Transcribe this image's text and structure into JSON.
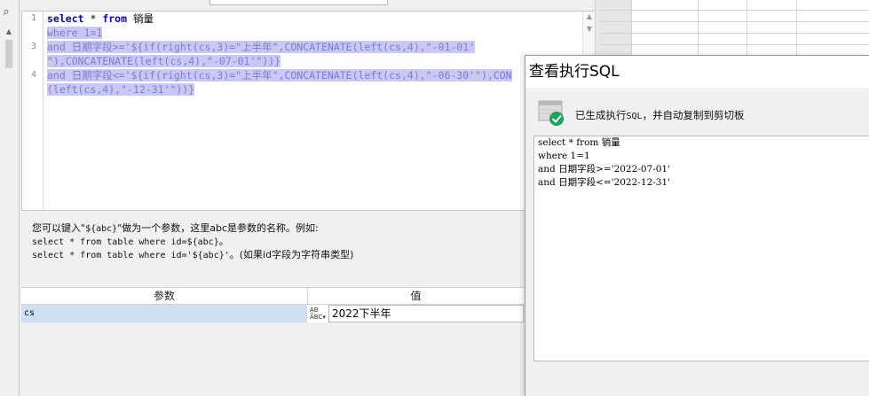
{
  "editor": {
    "line_numbers": [
      "1",
      "3",
      "4"
    ],
    "lines": {
      "l1_kw1": "select",
      "l1_mid": " * ",
      "l1_kw2": "from",
      "l1_rest": " 销量",
      "l2": "where 1=1",
      "l3a": "and 日期字段>='${if(right(cs,3)=\"上半年\",CONCATENATE(left(cs,4),\"-01-01'",
      "l3b": "\"),CONCATENATE(left(cs,4),\"-07-01'\"))}",
      "l4a": "and 日期字段<='${if(right(cs,3)=\"上半年\",CONCATENATE(left(cs,4),\"-06-30'\"),CON",
      "l4b": "(left(cs,4),\"-12-31'\"))}"
    }
  },
  "help": {
    "line1a": "您可以键入\"",
    "line1b": "${abc}",
    "line1c": "\"做为一个参数，这里abc是参数的名称。例如:",
    "line2a": "select * from table where id=${abc}",
    "line2b": "。",
    "line3a": "select * from table where id='${abc}'",
    "line3b": "。(如果id字段为字符串类型)"
  },
  "params": {
    "header_param": "参数",
    "header_value": "值",
    "rows": [
      {
        "name": "cs",
        "type_icon": "ab-type-icon",
        "value": "2022下半年"
      }
    ]
  },
  "dialog": {
    "title": "查看执行SQL",
    "message_a": "已生成执行",
    "message_b": "SQL",
    "message_c": "，并自动复制到剪切板",
    "sql_lines": [
      "select * from 销量",
      "where 1=1",
      "and 日期字段>='2022-07-01'",
      "and 日期字段<='2022-12-31'"
    ]
  },
  "colors": {
    "selection": "#c8c8f3",
    "keyword": "#0000c8",
    "selected_row": "#cfe0f2",
    "success": "#1aa35a"
  }
}
